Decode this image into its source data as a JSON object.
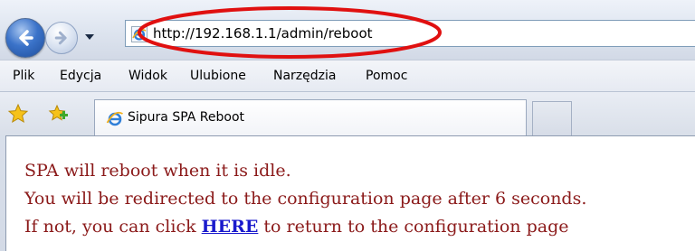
{
  "address_bar": {
    "url": "http://192.168.1.1/admin/reboot"
  },
  "menu": {
    "items": [
      "Plik",
      "Edycja",
      "Widok",
      "Ulubione",
      "Narzędzia",
      "Pomoc"
    ]
  },
  "tabs": [
    {
      "title": "Sipura SPA Reboot",
      "icon": "ie-logo-icon"
    }
  ],
  "page": {
    "line1": "SPA will reboot when it is idle.",
    "line2": "You will be redirected to the configuration page after 6 seconds.",
    "line3_before": "If not, you can click ",
    "line3_link": "HERE",
    "line3_after": " to return to the configuration page"
  },
  "icons": {
    "back": "back-arrow-icon",
    "forward": "forward-arrow-icon",
    "dropdown": "chevron-down-icon",
    "favorites": "favorites-star-icon",
    "add_favorite": "add-favorite-icon",
    "page": "ie-logo-icon"
  },
  "colors": {
    "annotation": "#e01010",
    "page_text": "#8b1a1a",
    "link": "#1a1acc"
  }
}
